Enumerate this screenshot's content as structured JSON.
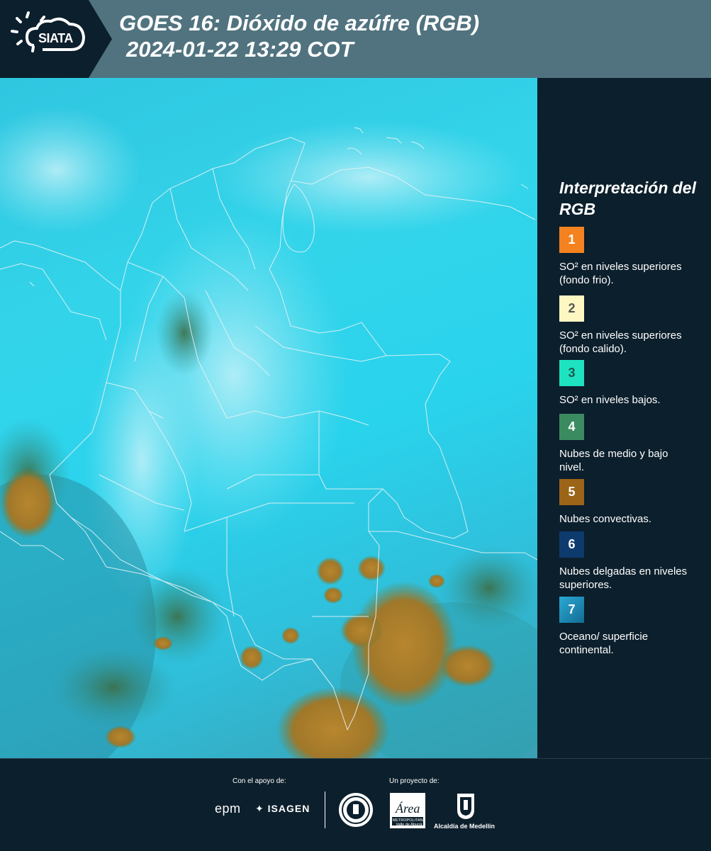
{
  "header": {
    "logo_text": "SIATA",
    "title_line1": "GOES 16: Dióxido de azúfre (RGB)",
    "title_line2": "2024-01-22 13:29 COT",
    "background_color": "#50737f"
  },
  "legend": {
    "title": "Interpretación del RGB",
    "items": [
      {
        "number": "1",
        "color": "#f58220",
        "label": "SO² en niveles superiores (fondo frio)."
      },
      {
        "number": "2",
        "color": "#fff7c2",
        "label": "SO² en niveles superiores (fondo calido)."
      },
      {
        "number": "3",
        "color": "#1de3c1",
        "label": "SO² en niveles bajos."
      },
      {
        "number": "4",
        "color": "#3a8c60",
        "label": "Nubes de medio y bajo nivel."
      },
      {
        "number": "5",
        "color": "#9c6416",
        "label": "Nubes convectivas."
      },
      {
        "number": "6",
        "color": "#0e3b6e",
        "label": "Nubes delgadas en niveles superiores."
      },
      {
        "number": "7",
        "color": "#1c8fb8",
        "label": "Oceano/ superficie continental."
      }
    ]
  },
  "footer": {
    "support_label": "Con el apoyo de:",
    "project_label": "Un proyecto de:",
    "sponsors": [
      "epm",
      "ISAGEN"
    ],
    "area_logo_text": "Área",
    "area_logo_caption": "METROPOLITANA Valle de Aburrá",
    "alcaldia_label": "Alcaldía de Medellín"
  },
  "map": {
    "description_colors": {
      "land_cyan": "#2fd0e8",
      "cloud_brown": "#9c7a26",
      "cloud_green": "#3d7a4c",
      "border": "#e6f2f5"
    }
  }
}
